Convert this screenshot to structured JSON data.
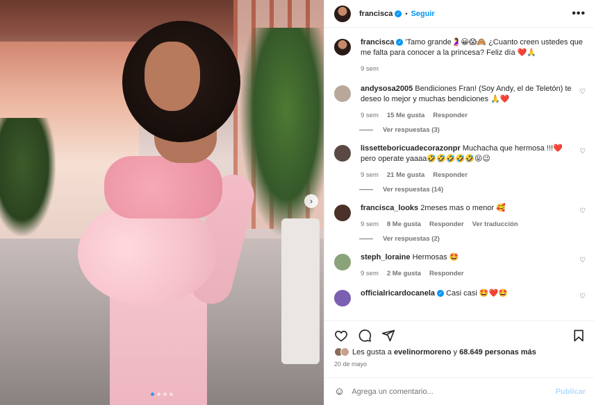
{
  "header": {
    "username": "francisca",
    "follow_label": "Seguir",
    "separator": "•",
    "more": "•••"
  },
  "caption": {
    "username": "francisca",
    "text": "'Tamo grande🤰😀😱🙈 ¿Cuanto creen ustedes que me falta para conocer a la princesa? Feliz día ❤️🙏",
    "time": "9 sem"
  },
  "comments": [
    {
      "username": "andysosa2005",
      "text": "Bendiciones Fran! (Soy Andy, el de Teletón) te deseo lo mejor y muchas bendiciones 🙏❤️",
      "time": "9 sem",
      "likes": "15 Me gusta",
      "reply": "Responder",
      "translate": "",
      "view_replies": "Ver respuestas (3)",
      "avatar_color": "#b9a79a"
    },
    {
      "username": "lissetteboricuadecorazonpr",
      "text": "Muchacha que hermosa !!!❤️pero operate yaaaa🤣🤣🤣🤣🤣😝😉",
      "time": "9 sem",
      "likes": "21 Me gusta",
      "reply": "Responder",
      "translate": "",
      "view_replies": "Ver respuestas (14)",
      "avatar_color": "#5a4a43"
    },
    {
      "username": "francisca_looks",
      "text": "2meses mas o menor 🥰",
      "time": "9 sem",
      "likes": "8 Me gusta",
      "reply": "Responder",
      "translate": "Ver traducción",
      "view_replies": "Ver respuestas (2)",
      "avatar_color": "#4a3129"
    },
    {
      "username": "steph_loraine",
      "text": "Hermosas 🤩",
      "time": "9 sem",
      "likes": "2 Me gusta",
      "reply": "Responder",
      "translate": "",
      "view_replies": "",
      "avatar_color": "#8aa37a"
    },
    {
      "username": "officialricardocanela",
      "text": "Casi casi 🤩❤️🤩",
      "time": "",
      "likes": "",
      "reply": "",
      "translate": "",
      "view_replies": "",
      "avatar_color": "#7b5fb0"
    }
  ],
  "likes": {
    "prefix": "Les gusta a",
    "user": "evelinormoreno",
    "middle": "y",
    "count": "68.649 personas más"
  },
  "date": "20 de mayo",
  "add_comment": {
    "placeholder": "Agrega un comentario...",
    "publish": "Publicar"
  },
  "colors": {
    "link_blue": "#0095f6",
    "muted": "#737373",
    "heart": "#ed4956"
  },
  "icons": [
    "heart-icon",
    "comment-icon",
    "share-icon",
    "bookmark-icon",
    "emoji-icon",
    "verified-icon",
    "chevron-right-icon",
    "more-icon"
  ]
}
